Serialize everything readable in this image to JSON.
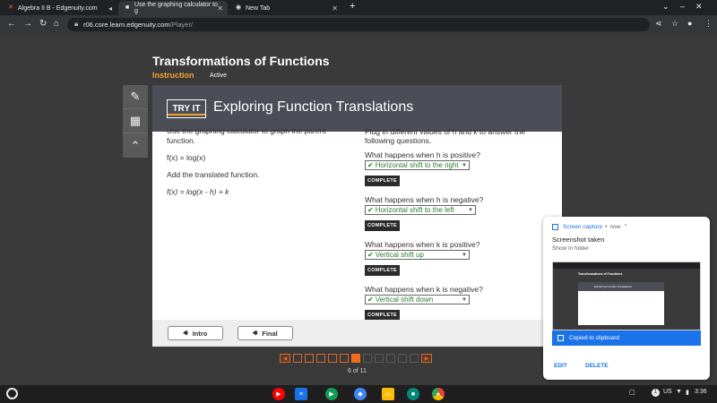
{
  "browser": {
    "tabs": [
      {
        "title": "Algebra II B - Edgenuity.com",
        "icon": "edgenuity-icon",
        "active": false
      },
      {
        "title": "Use the graphing calculator to g",
        "icon": "brainly-icon",
        "active": true
      },
      {
        "title": "New Tab",
        "icon": "chrome-icon",
        "active": false
      }
    ],
    "url_host": "r06.core.learn.edgenuity.com",
    "url_path": "/Player/"
  },
  "course": {
    "title": "Transformations of Functions",
    "section": "Instruction",
    "status": "Active"
  },
  "activity": {
    "badge": "TRY IT",
    "title": "Exploring Function Translations",
    "left_text": {
      "intro": "Use the graphing calculator to graph the parent function.",
      "parent_function": "f(x) = log(x)",
      "add_instruction": "Add the translated function.",
      "translated_function": "f(x) = log(x - h) + k"
    },
    "right_intro": "Plug in different values of h and k to answer the following questions.",
    "questions": [
      {
        "prompt": "What happens when h is positive?",
        "answer": "Horizontal shift to the right",
        "status": "COMPLETE"
      },
      {
        "prompt": "What happens when h is negative?",
        "answer": "Horizontal shift to the left",
        "status": "COMPLETE"
      },
      {
        "prompt": "What happens when k is positive?",
        "answer": "Vertical shift up",
        "status": "COMPLETE"
      },
      {
        "prompt": "What happens when k is negative?",
        "answer": "Vertical shift down",
        "status": "COMPLETE"
      }
    ],
    "footer": {
      "intro_label": "Intro",
      "final_label": "Final"
    }
  },
  "pager": {
    "current": 6,
    "total": 11,
    "label": "6 of 11"
  },
  "notification": {
    "app": "Screen capture",
    "time": "now",
    "title": "Screenshot taken",
    "subtitle": "Show in folder",
    "copied": "Copied to clipboard",
    "edit": "EDIT",
    "delete": "DELETE"
  },
  "shelf": {
    "locale": "US",
    "time": "3:36",
    "notif_count": "1"
  },
  "colors": {
    "accent": "#f7a12b",
    "header": "#4b4e57",
    "answer": "#2e7d32",
    "link": "#1a73e8"
  }
}
